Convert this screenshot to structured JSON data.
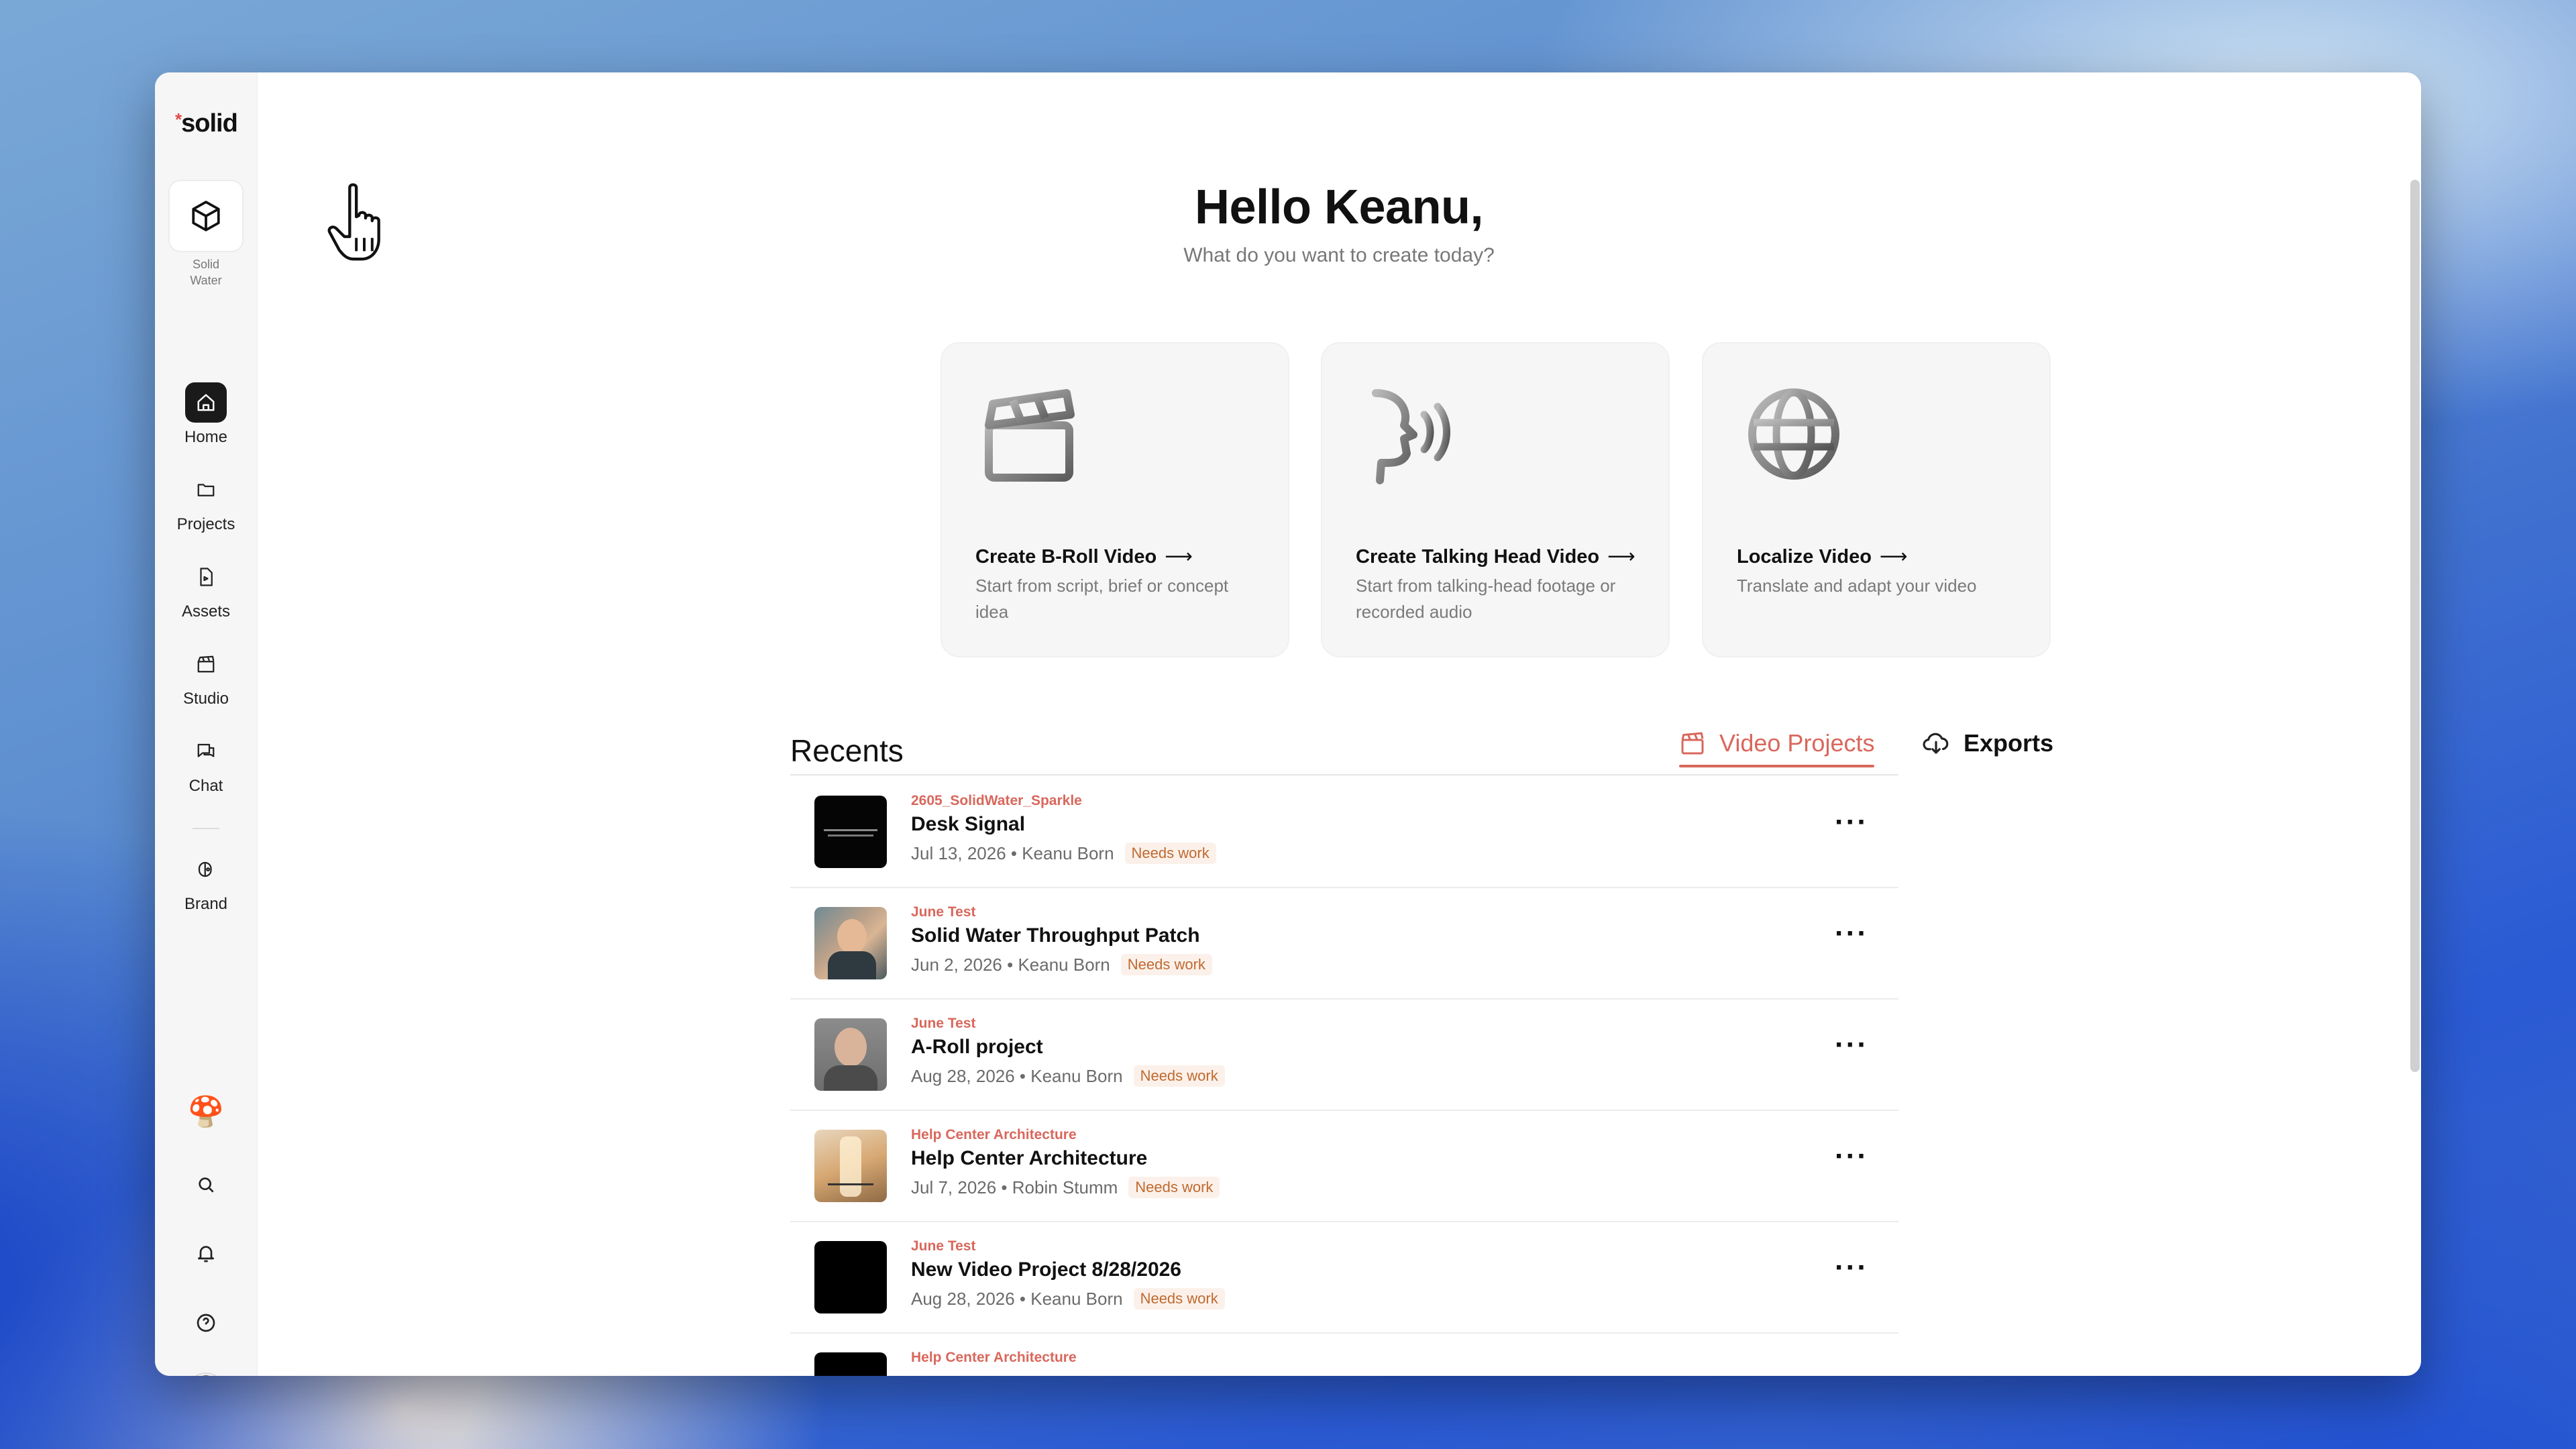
{
  "app": {
    "logo_text": "solid",
    "logo_mark": "*"
  },
  "workspace": {
    "name_line1": "Solid",
    "name_line2": "Water",
    "icon": "cube-icon"
  },
  "sidebar": {
    "items": [
      {
        "label": "Home",
        "icon": "home-icon",
        "active": true
      },
      {
        "label": "Projects",
        "icon": "folder-icon"
      },
      {
        "label": "Assets",
        "icon": "file-icon"
      },
      {
        "label": "Studio",
        "icon": "clapperboard-icon"
      },
      {
        "label": "Chat",
        "icon": "chat-icon"
      },
      {
        "label": "Brand",
        "icon": "brand-icon"
      }
    ],
    "bottom": [
      "mario-avatar",
      "search-icon",
      "bell-icon",
      "help-icon",
      "user-avatar"
    ]
  },
  "greeting": {
    "title": "Hello Keanu,",
    "subtitle": "What do you want to create today?"
  },
  "cards": [
    {
      "title": "Create B-Roll Video",
      "arrow": "⟶",
      "desc": "Start from script, brief or concept idea",
      "icon": "clapperboard-icon"
    },
    {
      "title": "Create Talking Head Video",
      "arrow": "⟶",
      "desc": "Start from talking-head footage or recorded audio",
      "icon": "speaking-head-icon"
    },
    {
      "title": "Localize Video",
      "arrow": "⟶",
      "desc": "Translate and adapt your video",
      "icon": "globe-icon"
    }
  ],
  "recents": {
    "title": "Recents",
    "tabs": [
      {
        "label": "Video Projects",
        "icon": "clapperboard-icon",
        "active": true
      },
      {
        "label": "Exports",
        "icon": "cloud-download-icon",
        "active": false
      }
    ],
    "rows": [
      {
        "folder": "2605_SolidWater_Sparkle",
        "name": "Desk Signal",
        "meta": "Jul 13, 2026 • Keanu Born",
        "badge": "Needs work",
        "thumb": "dark-text"
      },
      {
        "folder": "June Test",
        "name": "Solid Water Throughput Patch",
        "meta": "Jun 2, 2026 • Keanu Born",
        "badge": "Needs work",
        "thumb": "person-drink"
      },
      {
        "folder": "June Test",
        "name": "A-Roll project",
        "meta": "Aug 28, 2026 • Keanu Born",
        "badge": "Needs work",
        "thumb": "person"
      },
      {
        "folder": "Help Center Architecture",
        "name": "Help Center Architecture",
        "meta": "Jul 7, 2026 • Robin Stumm",
        "badge": "Needs work",
        "thumb": "bottle"
      },
      {
        "folder": "June Test",
        "name": "New Video Project 8/28/2026",
        "meta": "Aug 28, 2026 • Keanu Born",
        "badge": "Needs work",
        "thumb": "black"
      },
      {
        "folder": "Help Center Architecture",
        "name": "",
        "meta": "",
        "badge": "",
        "thumb": "black"
      }
    ],
    "more_glyph": "···"
  },
  "colors": {
    "accent": "#d9675c",
    "badge_bg": "#fbf1ea",
    "badge_text": "#c0692f"
  }
}
